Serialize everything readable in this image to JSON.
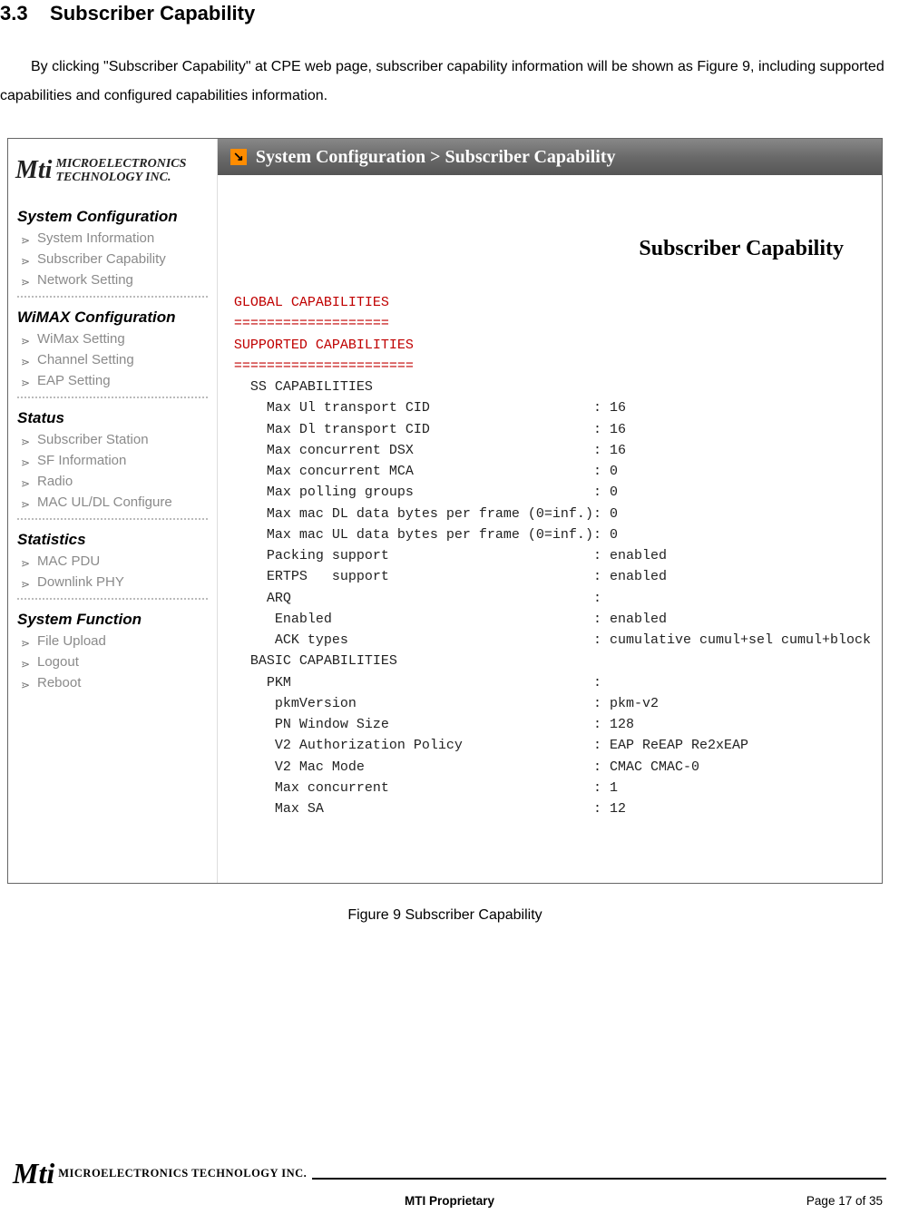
{
  "section_number": "3.3",
  "section_title": "Subscriber Capability",
  "paragraph": "By clicking \"Subscriber Capability\" at CPE web page, subscriber capability information will be shown as Figure 9, including supported capabilities and configured capabilities information.",
  "figure_caption": "Figure 9    Subscriber Capability",
  "footer_center": "MTI Proprietary",
  "footer_right": "Page 17 of 35",
  "footer_logo_text": "MICROELECTRONICS TECHNOLOGY INC.",
  "logo_sidebar_line1": "MICROELECTRONICS",
  "logo_sidebar_line2": "TECHNOLOGY INC.",
  "logo_mark": "Mti",
  "titlebar_text": "System Configuration > Subscriber Capability",
  "content_title": "Subscriber Capability",
  "nav": [
    {
      "title": "System Configuration",
      "items": [
        "System Information",
        "Subscriber Capability",
        "Network Setting"
      ]
    },
    {
      "title": "WiMAX Configuration",
      "items": [
        "WiMax Setting",
        "Channel Setting",
        "EAP Setting"
      ]
    },
    {
      "title": "Status",
      "items": [
        "Subscriber Station",
        "SF Information",
        "Radio",
        "MAC UL/DL Configure"
      ]
    },
    {
      "title": "Statistics",
      "items": [
        "MAC PDU",
        "Downlink PHY"
      ]
    },
    {
      "title": "System Function",
      "items": [
        "File Upload",
        "Logout",
        "Reboot"
      ]
    }
  ],
  "capability_headers": {
    "global": "GLOBAL CAPABILITIES",
    "global_rule": "===================",
    "supported": "SUPPORTED CAPABILITIES",
    "supported_rule": "======================",
    "ss": "SS CAPABILITIES",
    "basic": "BASIC CAPABILITIES"
  },
  "capability_rows": {
    "ss": [
      {
        "label": "Max Ul transport CID",
        "value": "16"
      },
      {
        "label": "Max Dl transport CID",
        "value": "16"
      },
      {
        "label": "Max concurrent DSX",
        "value": "16"
      },
      {
        "label": "Max concurrent MCA",
        "value": "0"
      },
      {
        "label": "Max polling groups",
        "value": "0"
      },
      {
        "label": "Max mac DL data bytes per frame (0=inf.)",
        "value": "0"
      },
      {
        "label": "Max mac UL data bytes per frame (0=inf.)",
        "value": "0"
      },
      {
        "label": "Packing support",
        "value": "enabled"
      },
      {
        "label": "ERTPS   support",
        "value": "enabled"
      },
      {
        "label": "ARQ",
        "value": ""
      },
      {
        "label": " Enabled",
        "value": "enabled"
      },
      {
        "label": " ACK types",
        "value": "cumulative cumul+sel cumul+block"
      }
    ],
    "basic": [
      {
        "label": "PKM",
        "value": ""
      },
      {
        "label": " pkmVersion",
        "value": "pkm-v2"
      },
      {
        "label": " PN Window Size",
        "value": "128"
      },
      {
        "label": " V2 Authorization Policy",
        "value": "EAP ReEAP Re2xEAP"
      },
      {
        "label": " V2 Mac Mode",
        "value": "CMAC CMAC-0"
      },
      {
        "label": " Max concurrent",
        "value": "1"
      },
      {
        "label": " Max SA",
        "value": "12"
      }
    ]
  }
}
